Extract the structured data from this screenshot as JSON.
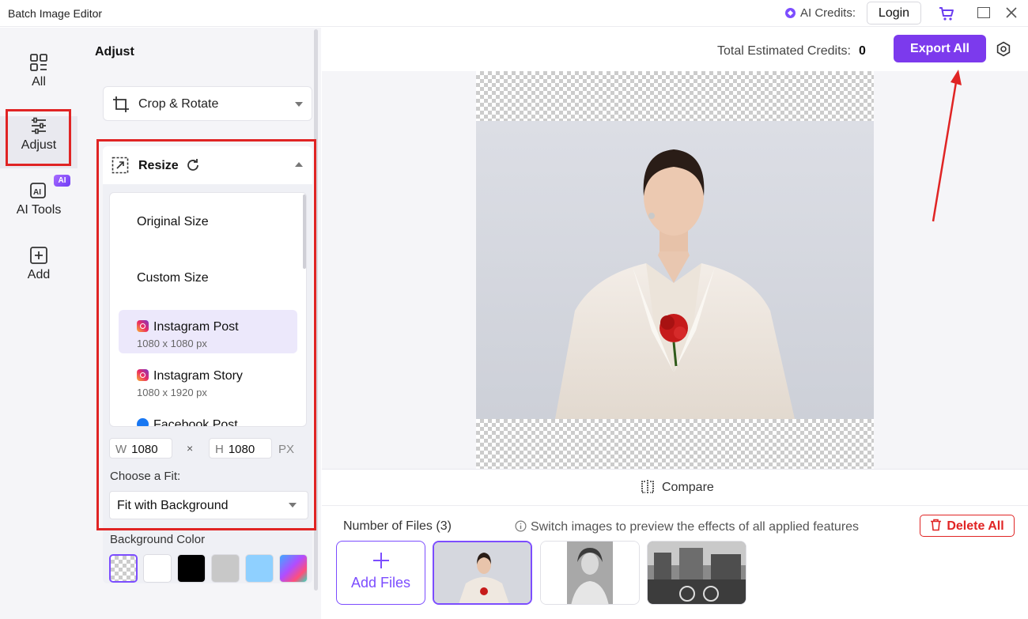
{
  "window": {
    "title": "Batch Image Editor",
    "credits_label": "AI Credits:",
    "login_label": "Login"
  },
  "rail": {
    "items": [
      {
        "label": "All",
        "icon": "grid-icon"
      },
      {
        "label": "Adjust",
        "icon": "sliders-icon"
      },
      {
        "label": "AI Tools",
        "icon": "ai-tools-icon",
        "badge": "AI"
      },
      {
        "label": "Add",
        "icon": "add-square-icon"
      }
    ]
  },
  "panel": {
    "title": "Adjust",
    "crop_rotate_label": "Crop & Rotate",
    "resize_label": "Resize",
    "sizes": [
      {
        "label": "Original Size",
        "sub": ""
      },
      {
        "label": "Custom Size",
        "sub": ""
      },
      {
        "label": "Instagram Post",
        "sub": "1080 x 1080 px",
        "icon": "instagram-icon"
      },
      {
        "label": "Instagram Story",
        "sub": "1080 x 1920 px",
        "icon": "instagram-icon"
      },
      {
        "label": "Facebook Post",
        "sub": "",
        "icon": "facebook-icon"
      }
    ],
    "width_prefix": "W",
    "width_value": "1080",
    "times": "×",
    "height_prefix": "H",
    "height_value": "1080",
    "unit": "PX",
    "fit_label": "Choose a Fit:",
    "fit_value": "Fit with Background",
    "bg_label": "Background Color",
    "swatches": [
      "transparent",
      "#ffffff",
      "#000000",
      "#c8c8c8",
      "#8fd0ff",
      "gradient"
    ]
  },
  "main": {
    "est_label": "Total Estimated Credits:",
    "est_value": "0",
    "export_label": "Export All",
    "compare_label": "Compare",
    "files_label": "Number of Files (3)",
    "hint": "Switch images to preview the effects of all applied features",
    "delete_label": "Delete All",
    "add_files_label": "Add Files"
  },
  "colors": {
    "accent": "#7c3aed",
    "highlight": "#e02424"
  }
}
